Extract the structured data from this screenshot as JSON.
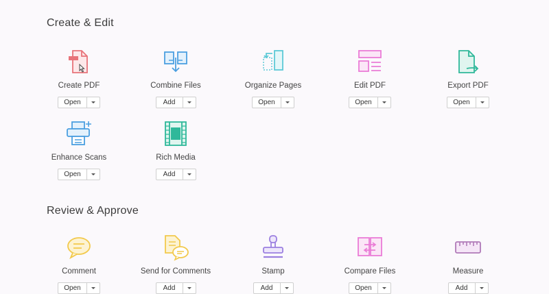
{
  "sections": {
    "create_edit": "Create & Edit",
    "review_approve": "Review & Approve"
  },
  "tools": {
    "create_pdf": {
      "label": "Create PDF",
      "action": "Open",
      "icon": "create-pdf-icon",
      "color": "#e8737a"
    },
    "combine_files": {
      "label": "Combine Files",
      "action": "Add",
      "icon": "combine-files-icon",
      "color": "#4a9fe0"
    },
    "organize_pages": {
      "label": "Organize Pages",
      "action": "Open",
      "icon": "organize-pages-icon",
      "color": "#5cc9d6"
    },
    "edit_pdf": {
      "label": "Edit PDF",
      "action": "Open",
      "icon": "edit-pdf-icon",
      "color": "#ea7cd6"
    },
    "export_pdf": {
      "label": "Export PDF",
      "action": "Open",
      "icon": "export-pdf-icon",
      "color": "#2fb89a"
    },
    "enhance_scans": {
      "label": "Enhance Scans",
      "action": "Open",
      "icon": "enhance-scans-icon",
      "color": "#4a9fe0"
    },
    "rich_media": {
      "label": "Rich Media",
      "action": "Add",
      "icon": "rich-media-icon",
      "color": "#2fb89a"
    },
    "comment": {
      "label": "Comment",
      "action": "Open",
      "icon": "comment-icon",
      "color": "#f2c94c"
    },
    "send_for_comments": {
      "label": "Send for Comments",
      "action": "Add",
      "icon": "send-for-comments-icon",
      "color": "#f2c94c"
    },
    "stamp": {
      "label": "Stamp",
      "action": "Add",
      "icon": "stamp-icon",
      "color": "#9b7fe0"
    },
    "compare_files": {
      "label": "Compare Files",
      "action": "Open",
      "icon": "compare-files-icon",
      "color": "#ea7cd6"
    },
    "measure": {
      "label": "Measure",
      "action": "Add",
      "icon": "measure-icon",
      "color": "#b07ab8"
    }
  }
}
